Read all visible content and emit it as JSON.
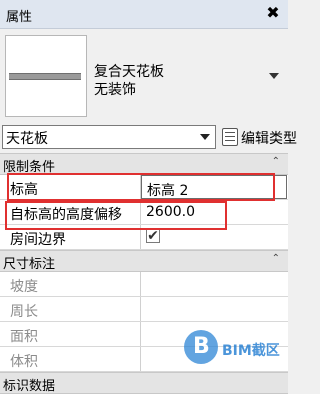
{
  "panel": {
    "title": "属性",
    "close": "✖"
  },
  "type_selector": {
    "name": "复合天花板",
    "subtitle": "无装饰"
  },
  "family_select": {
    "value": "天花板",
    "edit_type_label": "编辑类型"
  },
  "categories": [
    {
      "label": "限制条件",
      "chevron": "⌃"
    },
    {
      "label": "尺寸标注",
      "chevron": "⌃"
    },
    {
      "label": "标识数据"
    }
  ],
  "constraints": [
    {
      "label": "标高",
      "value": "标高 2"
    },
    {
      "label": "自标高的高度偏移",
      "value": "2600.0"
    },
    {
      "label": "房间边界",
      "value": "✔"
    }
  ],
  "dimensions": [
    {
      "label": "坡度",
      "value": ""
    },
    {
      "label": "周长",
      "value": ""
    },
    {
      "label": "面积",
      "value": ""
    },
    {
      "label": "体积",
      "value": ""
    }
  ],
  "watermark": {
    "logo": "B",
    "text": "BIM截区"
  },
  "colors": {
    "highlight": "#e03030",
    "header": "#dfe6f0"
  }
}
